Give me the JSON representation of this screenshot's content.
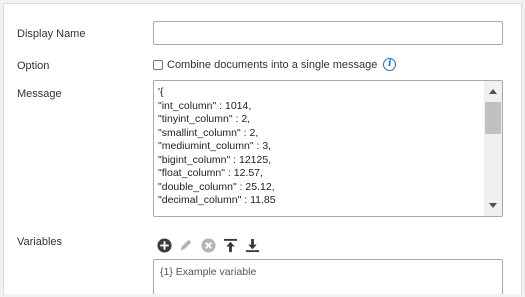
{
  "form": {
    "display_name": {
      "label": "Display Name",
      "value": ""
    },
    "option": {
      "label": "Option",
      "checkbox_label": "Combine documents into a single message",
      "checked": false
    },
    "message": {
      "label": "Message",
      "lines": [
        "'{",
        "\"int_column\" : 1014,",
        "\"tinyint_column\" : 2,",
        "\"smallint_column\" : 2,",
        "\"mediumint_column\" : 3,",
        "\"bigint_column\" : 12125,",
        "\"float_column\" : 12.57,",
        "\"double_column\" : 25.12,",
        "\"decimal_column\" : 11.85"
      ]
    },
    "variables": {
      "label": "Variables",
      "items": [
        "{1} Example variable"
      ]
    }
  },
  "toolbar": {
    "icons": [
      "add-icon",
      "edit-icon",
      "delete-icon",
      "move-top-icon",
      "move-bottom-icon"
    ]
  },
  "colors": {
    "accent": "#1e6fd0",
    "icon_dark": "#3a3a3a",
    "icon_disabled": "#b4b4b4"
  }
}
